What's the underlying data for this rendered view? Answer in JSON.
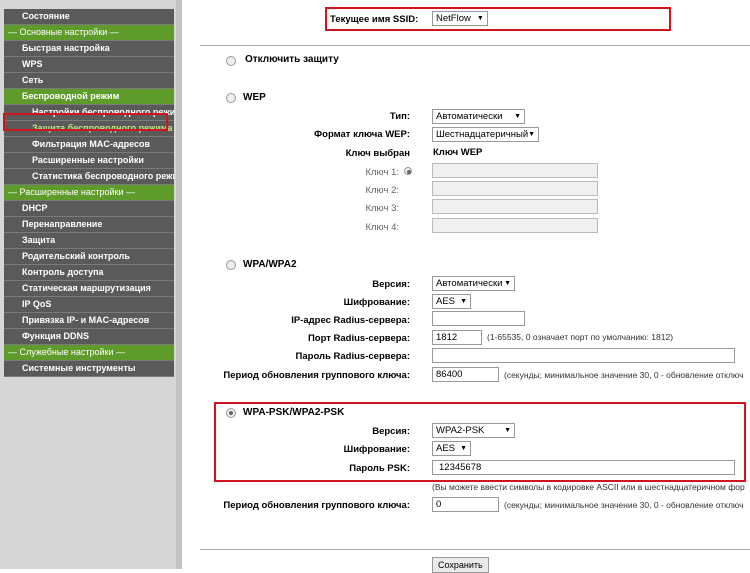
{
  "sidebar": {
    "items": [
      {
        "label": "Состояние"
      },
      {
        "label": "— Основные настройки —"
      },
      {
        "label": "Быстрая настройка"
      },
      {
        "label": "WPS"
      },
      {
        "label": "Сеть"
      },
      {
        "label": "Беспроводной режим"
      },
      {
        "label": "Настройки беспроводного режима"
      },
      {
        "label": "Защита беспроводного режима"
      },
      {
        "label": "Фильтрация MAC-адресов"
      },
      {
        "label": "Расширенные настройки"
      },
      {
        "label": "Статистика беспроводного режима"
      },
      {
        "label": "— Расширенные настройки —"
      },
      {
        "label": "DHCP"
      },
      {
        "label": "Перенаправление"
      },
      {
        "label": "Защита"
      },
      {
        "label": "Родительский контроль"
      },
      {
        "label": "Контроль доступа"
      },
      {
        "label": "Статическая маршрутизация"
      },
      {
        "label": "IP QoS"
      },
      {
        "label": "Привязка IP- и MAC-адресов"
      },
      {
        "label": "Функция DDNS"
      },
      {
        "label": "— Служебные настройки —"
      },
      {
        "label": "Системные инструменты"
      }
    ]
  },
  "ssid": {
    "label": "Текущее имя SSID:",
    "value": "NetFlow"
  },
  "disable": {
    "label": "Отключить защиту"
  },
  "wep": {
    "title": "WEP",
    "type_label": "Тип:",
    "type_value": "Автоматически",
    "format_label": "Формат ключа WEP:",
    "format_value": "Шестнадцатеричный",
    "selected_label": "Ключ выбран",
    "key_header": "Ключ WEP",
    "keys": [
      "Ключ 1:",
      "Ключ 2:",
      "Ключ 3:",
      "Ключ 4:"
    ]
  },
  "wpa": {
    "title": "WPA/WPA2",
    "version_label": "Версия:",
    "version_value": "Автоматически",
    "enc_label": "Шифрование:",
    "enc_value": "AES",
    "radius_ip_label": "IP-адрес Radius-сервера:",
    "radius_port_label": "Порт Radius-сервера:",
    "radius_port_value": "1812",
    "radius_port_note": "(1-65535, 0 означает порт по умолчанию: 1812)",
    "radius_pass_label": "Пароль Radius-сервера:",
    "group_label": "Период обновления группового ключа:",
    "group_value": "86400",
    "group_note": "(секунды; минимальное значение 30, 0 - обновление отключ"
  },
  "psk": {
    "title": "WPA-PSK/WPA2-PSK",
    "version_label": "Версия:",
    "version_value": "WPA2-PSK",
    "enc_label": "Шифрование:",
    "enc_value": "AES",
    "pass_label": "Пароль PSK:",
    "pass_value": "12345678",
    "pass_note": "(Вы можете ввести символы в кодировке ASCII или в шестнадцатеричном фор",
    "group_label": "Период обновления группового ключа:",
    "group_value": "0",
    "group_note": "(секунды; минимальное значение 30, 0 - обновление отключ"
  },
  "save_label": "Сохранить"
}
